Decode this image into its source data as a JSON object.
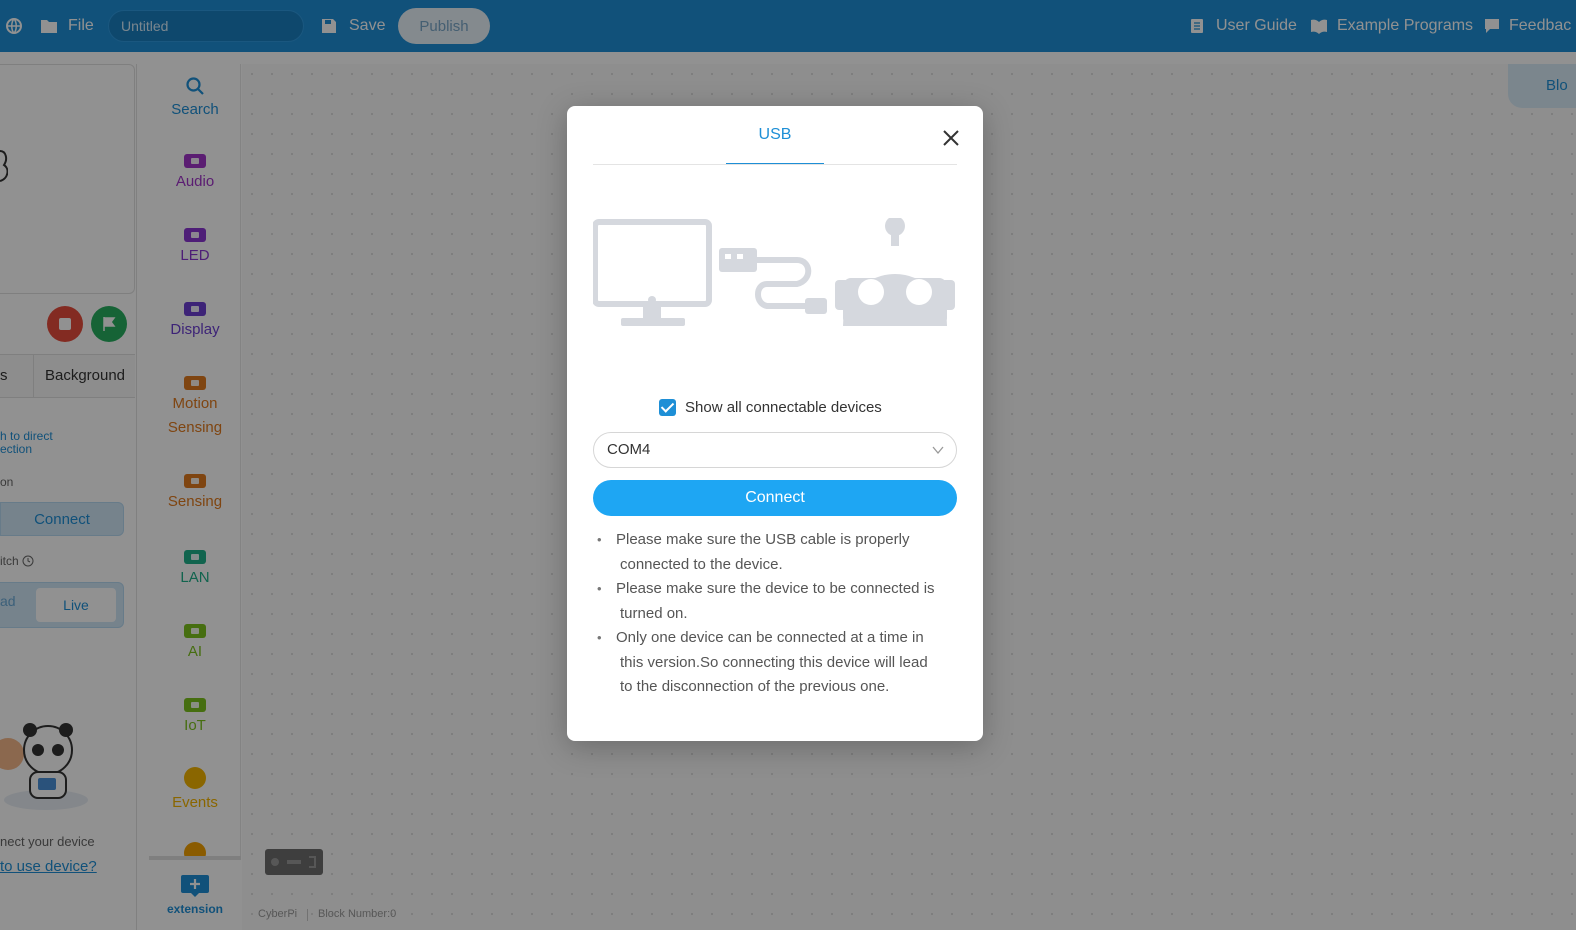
{
  "topbar": {
    "file_label": "File",
    "title_value": "Untitled",
    "save_label": "Save",
    "publish_label": "Publish",
    "user_guide_label": "User Guide",
    "example_programs_label": "Example Programs",
    "feedback_label": "Feedbac"
  },
  "stage": {
    "tab_sprites_partial": "s",
    "tab_background": "Background",
    "switch_direct_connection_line1": "h to direct",
    "switch_direct_connection_line2": "ection",
    "connection_partial": "on",
    "connect_label": "Connect",
    "switch_partial": "itch",
    "upload_partial": "ad",
    "live_label": "Live",
    "connect_your_device": "nect your device",
    "how_to_use_device": "to use device?"
  },
  "categories": [
    {
      "label": "Search",
      "color": "#1e8fd6",
      "icon": "search-icon"
    },
    {
      "label": "Audio",
      "color": "#a033c9",
      "icon": "audio-icon"
    },
    {
      "label": "LED",
      "color": "#8a35d1",
      "icon": "led-icon"
    },
    {
      "label": "Display",
      "color": "#6b3fd1",
      "icon": "display-icon"
    },
    {
      "label": "Motion Sensing",
      "color": "#e07a1e",
      "icon": "motion-sensing-icon"
    },
    {
      "label": "Sensing",
      "color": "#e07a1e",
      "icon": "sensing-icon"
    },
    {
      "label": "LAN",
      "color": "#1fb08a",
      "icon": "lan-icon"
    },
    {
      "label": "AI",
      "color": "#7cc11d",
      "icon": "ai-icon"
    },
    {
      "label": "IoT",
      "color": "#7cc11d",
      "icon": "iot-icon"
    },
    {
      "label": "Events",
      "color": "#f2b400",
      "icon": "events-icon"
    }
  ],
  "extension_label": "extension",
  "workspace": {
    "blocks_tab_label": "Blo",
    "footer_device": "CyberPi",
    "footer_blocks": "Block Number:0"
  },
  "modal": {
    "tab_usb": "USB",
    "show_all_label": "Show all connectable devices",
    "show_all_checked": true,
    "port_value": "COM4",
    "connect_label": "Connect",
    "notes": [
      {
        "l1": "Please make sure the USB cable is properly",
        "l2": "connected to the device."
      },
      {
        "l1": "Please make sure the device to be connected is",
        "l2": "turned on."
      },
      {
        "l1": "Only one device can be connected at a time in",
        "l2": "this version.So connecting this device will lead",
        "l3": "to the disconnection of the previous one."
      }
    ]
  },
  "colors": {
    "topbar": "#1e8fd6",
    "primary_button": "#1ea6f3",
    "accent": "#1e8fd6",
    "stop": "#e74c3c",
    "go": "#27ae60"
  }
}
